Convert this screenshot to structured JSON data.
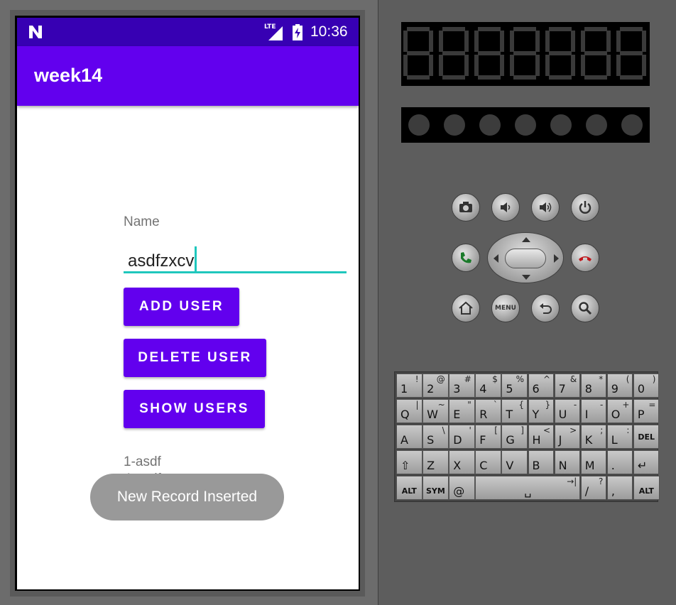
{
  "status_bar": {
    "network": "LTE",
    "time": "10:36"
  },
  "app_bar": {
    "title": "week14"
  },
  "form": {
    "name_label": "Name",
    "name_value": "asdfzxcv"
  },
  "buttons": {
    "add": "ADD USER",
    "delete": "DELETE USER",
    "show": "SHOW USERS"
  },
  "users_list": [
    "1-asdf",
    "4-asdfzxcv"
  ],
  "toast": {
    "message": "New Record Inserted"
  },
  "colors": {
    "status_bar": "#3700b3",
    "primary": "#6200ee",
    "accent": "#1fc7bd",
    "toast_bg": "#999999"
  },
  "emulator_controls": {
    "top_row_icons": [
      "camera-icon",
      "volume-down-icon",
      "volume-up-icon",
      "power-icon"
    ],
    "middle_icons": [
      "call-icon",
      "dpad-icon",
      "end-call-icon"
    ],
    "bottom_row": [
      "home-icon",
      "menu-label",
      "back-icon",
      "search-icon"
    ],
    "menu_label": "MENU"
  },
  "keyboard": {
    "row1": [
      {
        "main": "1",
        "alt": "!"
      },
      {
        "main": "2",
        "alt": "@"
      },
      {
        "main": "3",
        "alt": "#"
      },
      {
        "main": "4",
        "alt": "$"
      },
      {
        "main": "5",
        "alt": "%"
      },
      {
        "main": "6",
        "alt": "^"
      },
      {
        "main": "7",
        "alt": "&"
      },
      {
        "main": "8",
        "alt": "*"
      },
      {
        "main": "9",
        "alt": "("
      },
      {
        "main": "0",
        "alt": ")"
      }
    ],
    "row2": [
      {
        "main": "Q",
        "alt": "|"
      },
      {
        "main": "W",
        "alt": "~"
      },
      {
        "main": "E",
        "alt": "\""
      },
      {
        "main": "R",
        "alt": "`"
      },
      {
        "main": "T",
        "alt": "{"
      },
      {
        "main": "Y",
        "alt": "}"
      },
      {
        "main": "U",
        "alt": "-"
      },
      {
        "main": "I",
        "alt": "-"
      },
      {
        "main": "O",
        "alt": "+"
      },
      {
        "main": "P",
        "alt": "="
      }
    ],
    "row3": [
      {
        "main": "A",
        "alt": ""
      },
      {
        "main": "S",
        "alt": "\\"
      },
      {
        "main": "D",
        "alt": "'"
      },
      {
        "main": "F",
        "alt": "["
      },
      {
        "main": "G",
        "alt": "]"
      },
      {
        "main": "H",
        "alt": "<"
      },
      {
        "main": "J",
        "alt": ">"
      },
      {
        "main": "K",
        "alt": ";"
      },
      {
        "main": "L",
        "alt": ":"
      },
      {
        "main": "DEL",
        "alt": ""
      }
    ],
    "row4": [
      {
        "main": "⇧",
        "alt": ""
      },
      {
        "main": "Z",
        "alt": ""
      },
      {
        "main": "X",
        "alt": ""
      },
      {
        "main": "C",
        "alt": ""
      },
      {
        "main": "V",
        "alt": ""
      },
      {
        "main": "B",
        "alt": ""
      },
      {
        "main": "N",
        "alt": ""
      },
      {
        "main": "M",
        "alt": ""
      },
      {
        "main": ".",
        "alt": ""
      },
      {
        "main": "↵",
        "alt": ""
      }
    ],
    "row5": [
      {
        "main": "ALT",
        "alt": ""
      },
      {
        "main": "SYM",
        "alt": ""
      },
      {
        "main": "@",
        "alt": ""
      },
      {
        "main": "␣",
        "alt": "→|"
      },
      {
        "main": "/",
        "alt": "?"
      },
      {
        "main": ",",
        "alt": ""
      },
      {
        "main": "ALT",
        "alt": ""
      }
    ]
  }
}
